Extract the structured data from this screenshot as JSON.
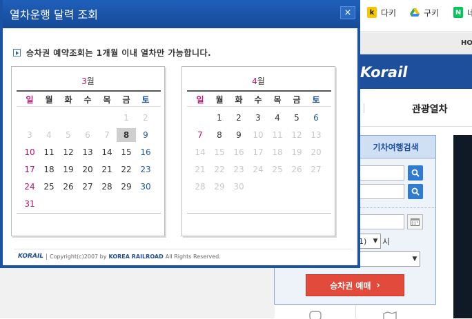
{
  "popup": {
    "title": "열차운행 달력 조회",
    "close": "×",
    "notice": "승차권 예약조회는 1개월 이내 열차만 가능합니다.",
    "footer": {
      "logo": "KORAIL",
      "copyright": "Copyright(c)2007 by",
      "company": "KOREA RAILROAD",
      "rights": "All Rights Reserved."
    }
  },
  "weekdays": [
    "일",
    "월",
    "화",
    "수",
    "목",
    "금",
    "토"
  ],
  "calendars": [
    {
      "month_num": "3",
      "month_unit": "월",
      "today": "8",
      "weeks": [
        [
          {
            "d": "",
            "s": ""
          },
          {
            "d": "",
            "s": ""
          },
          {
            "d": "",
            "s": ""
          },
          {
            "d": "",
            "s": ""
          },
          {
            "d": "",
            "s": ""
          },
          {
            "d": "1",
            "s": "dis"
          },
          {
            "d": "2",
            "s": "dis"
          }
        ],
        [
          {
            "d": "3",
            "s": "dis"
          },
          {
            "d": "4",
            "s": "dis"
          },
          {
            "d": "5",
            "s": "dis"
          },
          {
            "d": "6",
            "s": "dis"
          },
          {
            "d": "7",
            "s": "dis"
          },
          {
            "d": "8",
            "s": "today"
          },
          {
            "d": "9",
            "s": "sat"
          }
        ],
        [
          {
            "d": "10",
            "s": "sun"
          },
          {
            "d": "11",
            "s": ""
          },
          {
            "d": "12",
            "s": ""
          },
          {
            "d": "13",
            "s": ""
          },
          {
            "d": "14",
            "s": ""
          },
          {
            "d": "15",
            "s": ""
          },
          {
            "d": "16",
            "s": "sat"
          }
        ],
        [
          {
            "d": "17",
            "s": "sun"
          },
          {
            "d": "18",
            "s": ""
          },
          {
            "d": "19",
            "s": ""
          },
          {
            "d": "20",
            "s": ""
          },
          {
            "d": "21",
            "s": ""
          },
          {
            "d": "22",
            "s": ""
          },
          {
            "d": "23",
            "s": "sat"
          }
        ],
        [
          {
            "d": "24",
            "s": "sun"
          },
          {
            "d": "25",
            "s": ""
          },
          {
            "d": "26",
            "s": ""
          },
          {
            "d": "27",
            "s": ""
          },
          {
            "d": "28",
            "s": ""
          },
          {
            "d": "29",
            "s": ""
          },
          {
            "d": "30",
            "s": "sat"
          }
        ],
        [
          {
            "d": "31",
            "s": "sun"
          },
          {
            "d": "",
            "s": ""
          },
          {
            "d": "",
            "s": ""
          },
          {
            "d": "",
            "s": ""
          },
          {
            "d": "",
            "s": ""
          },
          {
            "d": "",
            "s": ""
          },
          {
            "d": "",
            "s": ""
          }
        ]
      ]
    },
    {
      "month_num": "4",
      "month_unit": "월",
      "today": "",
      "weeks": [
        [
          {
            "d": "",
            "s": ""
          },
          {
            "d": "1",
            "s": ""
          },
          {
            "d": "2",
            "s": ""
          },
          {
            "d": "3",
            "s": ""
          },
          {
            "d": "4",
            "s": ""
          },
          {
            "d": "5",
            "s": ""
          },
          {
            "d": "6",
            "s": "sat"
          }
        ],
        [
          {
            "d": "7",
            "s": "sun"
          },
          {
            "d": "8",
            "s": ""
          },
          {
            "d": "9",
            "s": ""
          },
          {
            "d": "10",
            "s": "dis"
          },
          {
            "d": "11",
            "s": "dis"
          },
          {
            "d": "12",
            "s": "dis"
          },
          {
            "d": "13",
            "s": "dis"
          }
        ],
        [
          {
            "d": "14",
            "s": "dis"
          },
          {
            "d": "15",
            "s": "dis"
          },
          {
            "d": "16",
            "s": "dis"
          },
          {
            "d": "17",
            "s": "dis"
          },
          {
            "d": "18",
            "s": "dis"
          },
          {
            "d": "19",
            "s": "dis"
          },
          {
            "d": "20",
            "s": "dis"
          }
        ],
        [
          {
            "d": "21",
            "s": "dis"
          },
          {
            "d": "22",
            "s": "dis"
          },
          {
            "d": "23",
            "s": "dis"
          },
          {
            "d": "24",
            "s": "dis"
          },
          {
            "d": "25",
            "s": "dis"
          },
          {
            "d": "26",
            "s": "dis"
          },
          {
            "d": "27",
            "s": "dis"
          }
        ],
        [
          {
            "d": "28",
            "s": "dis"
          },
          {
            "d": "29",
            "s": "dis"
          },
          {
            "d": "30",
            "s": "dis"
          },
          {
            "d": "",
            "s": ""
          },
          {
            "d": "",
            "s": ""
          },
          {
            "d": "",
            "s": ""
          },
          {
            "d": "",
            "s": ""
          }
        ]
      ]
    }
  ],
  "background": {
    "bookmarks": [
      {
        "icon": "k",
        "label": "다키"
      },
      {
        "icon": "google-drive-icon",
        "label": "구키"
      },
      {
        "icon": "N",
        "label": "네"
      }
    ],
    "util_text": "HO",
    "logo": "Korail",
    "menu_tour": "관광열차",
    "booking_tab": "기차여행검색",
    "select_partial": "1)",
    "select_unit": "시",
    "reserve_button": "승차권 예매"
  },
  "colors": {
    "title_bar": "#1a52a6",
    "sunday": "#b8126e",
    "saturday": "#1d5a9a",
    "reserve": "#e24a3b"
  }
}
